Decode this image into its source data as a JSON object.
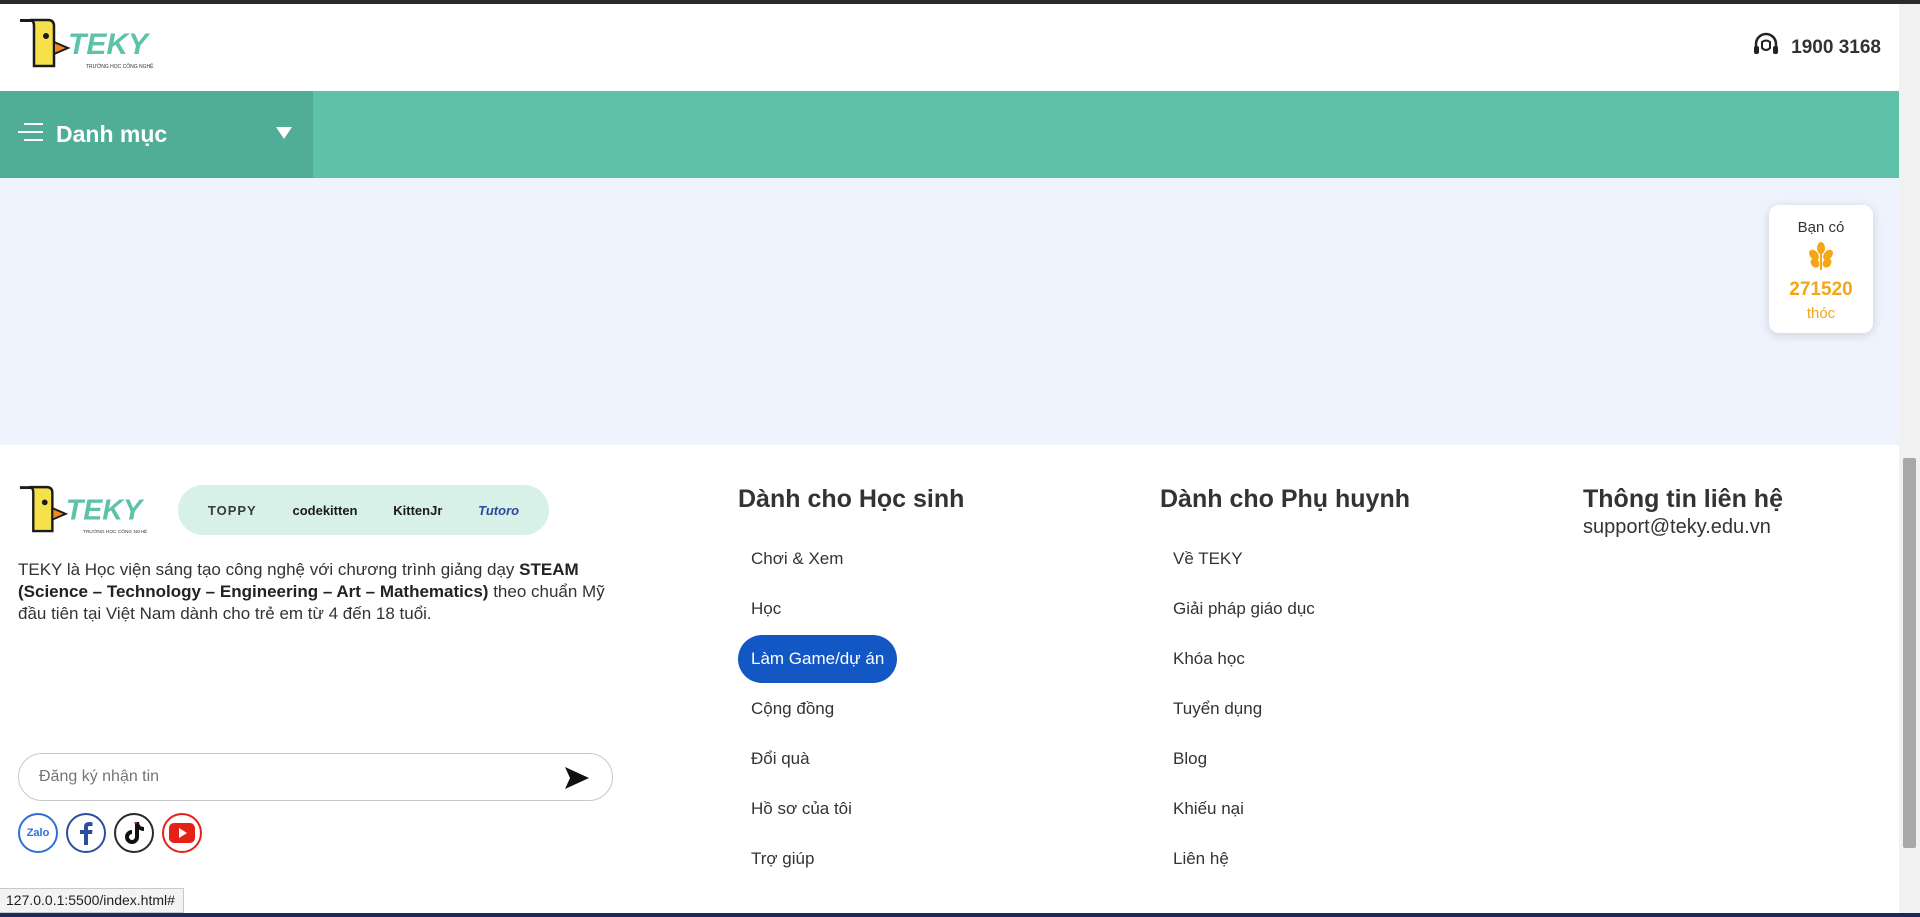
{
  "header": {
    "logo_text": "TEKY",
    "logo_subtext": "TRƯỜNG HỌC CÔNG NGHỆ",
    "phone": "1900 3168",
    "icons": {
      "phone": "headset-icon"
    }
  },
  "nav": {
    "category_label": "Danh mục",
    "icons": {
      "menu": "menu-lines-icon",
      "caret": "caret-down-icon"
    }
  },
  "points": {
    "label": "Bạn có",
    "value": "271520",
    "unit": "thóc",
    "icon": "rice-grain-icon",
    "color": "#f4a617"
  },
  "footer": {
    "partners": [
      "TOPPY",
      "codekitten",
      "KittenJr",
      "Tutoro"
    ],
    "about_prefix": "TEKY là Học viện sáng tạo công nghệ với chương trình giảng dạy ",
    "about_bold": "STEAM (Science – Technology – Engineering – Art – Mathematics)",
    "about_suffix": " theo chuẩn Mỹ đầu tiên tại Việt Nam dành cho trẻ em từ 4 đến 18 tuổi.",
    "subscribe_placeholder": "Đăng ký nhận tin",
    "socials": [
      "Zalo",
      "facebook-icon",
      "tiktok-icon",
      "youtube-icon"
    ],
    "students": {
      "title": "Dành cho Học sinh",
      "items": [
        "Chơi & Xem",
        "Học",
        "Làm Game/dự án",
        "Cộng đồng",
        "Đổi quà",
        "Hồ sơ của tôi",
        "Trợ giúp"
      ],
      "active_index": 2
    },
    "parents": {
      "title": "Dành cho Phụ huynh",
      "items": [
        "Về TEKY",
        "Giải pháp giáo dục",
        "Khóa học",
        "Tuyển dụng",
        "Blog",
        "Khiếu nại",
        "Liên hệ"
      ]
    },
    "contact": {
      "title": "Thông tin liên hệ",
      "email": "support@teky.edu.vn"
    }
  },
  "status_url": "127.0.0.1:5500/index.html#",
  "colors": {
    "accent": "#5ec2a9",
    "accent_dark": "#50ad96",
    "active_link": "#1257c4",
    "content_bg": "#eef3fd"
  }
}
